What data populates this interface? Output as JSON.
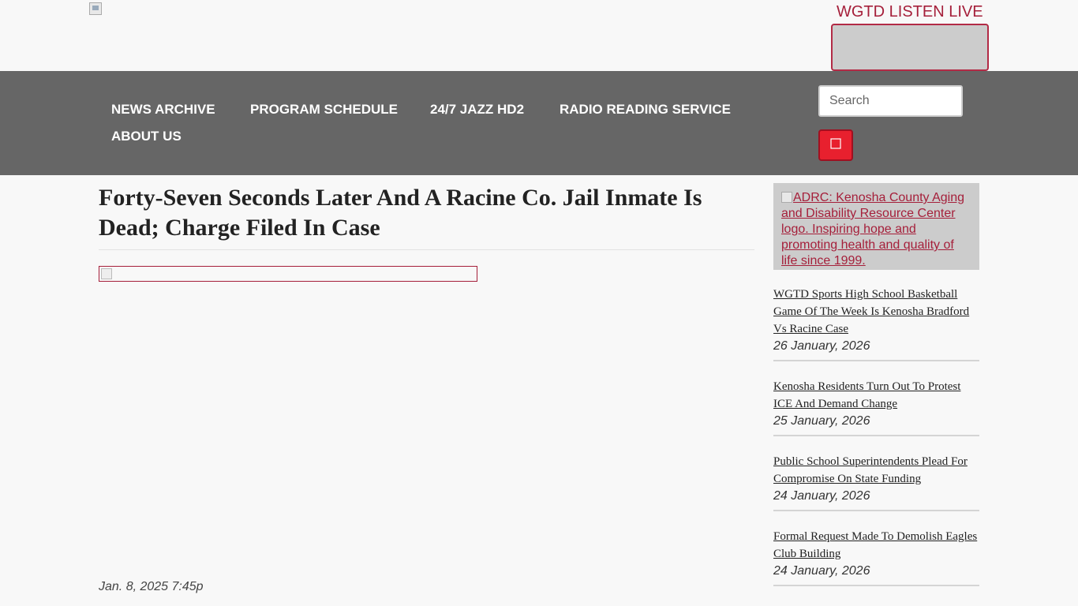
{
  "header": {
    "listen_live_label": "WGTD LISTEN LIVE"
  },
  "nav": {
    "items": [
      {
        "label": "NEWS ARCHIVE"
      },
      {
        "label": "PROGRAM SCHEDULE"
      },
      {
        "label": "24/7 JAZZ HD2"
      },
      {
        "label": "RADIO READING SERVICE"
      },
      {
        "label": "ABOUT US"
      }
    ],
    "search_placeholder": "Search",
    "search_button_icon": "search-icon"
  },
  "article": {
    "title": "Forty-Seven Seconds Later And A Racine Co. Jail Inmate Is Dead; Charge Filed In Case",
    "date": "Jan. 8, 2025 7:45p"
  },
  "sidebar": {
    "ad_alt_text": "ADRC: Kenosha County Aging and Disability Resource Center logo. Inspiring hope and promoting health and quality of life since 1999.",
    "news": [
      {
        "title": "WGTD Sports High School Basketball Game Of The Week Is Kenosha Bradford Vs Racine Case",
        "date": "26 January, 2026"
      },
      {
        "title": "Kenosha Residents Turn Out To Protest ICE And Demand Change",
        "date": "25 January, 2026"
      },
      {
        "title": "Public School Superintendents Plead For Compromise On State Funding",
        "date": "24 January, 2026"
      },
      {
        "title": "Formal Request Made To Demolish Eagles Club Building",
        "date": "24 January, 2026"
      }
    ]
  },
  "colors": {
    "brand_red": "#a51f3a",
    "nav_bg": "#666666",
    "search_button": "#e8202e",
    "sidebar_ad_bg": "#cccccc"
  }
}
